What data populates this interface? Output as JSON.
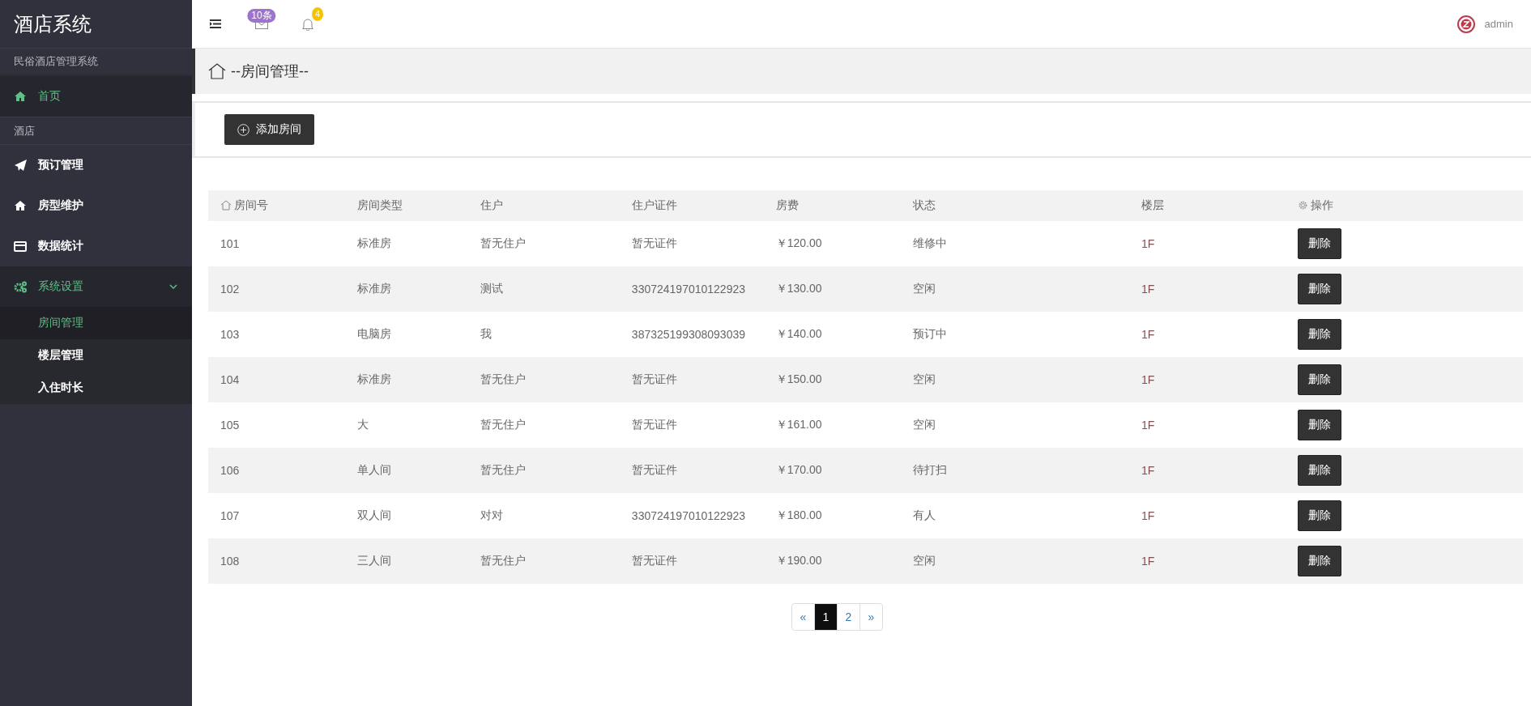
{
  "sidebar": {
    "title": "酒店系统",
    "subtitle": "民俗酒店管理系统",
    "items": [
      {
        "kind": "link",
        "label": "首页",
        "selected": true
      },
      {
        "kind": "section",
        "label": "酒店"
      },
      {
        "kind": "link",
        "label": "预订管理",
        "selected": false
      },
      {
        "kind": "link",
        "label": "房型维护",
        "selected": false
      },
      {
        "kind": "link",
        "label": "数据统计",
        "selected": false
      },
      {
        "kind": "menu",
        "label": "系统设置",
        "expanded": true,
        "children": [
          {
            "label": "房间管理",
            "selected": true
          },
          {
            "label": "楼层管理",
            "selected": false
          },
          {
            "label": "入住时长",
            "selected": false
          }
        ]
      }
    ]
  },
  "topbar": {
    "mail_badge": "10条",
    "bell_badge": "4",
    "user": "admin"
  },
  "page_title": "--房间管理--",
  "add_button": "添加房间",
  "table": {
    "columns": [
      "房间号",
      "房间类型",
      "住户",
      "住户证件",
      "房费",
      "状态",
      "楼层",
      "操作"
    ],
    "rows": [
      [
        "101",
        "标准房",
        "暂无住户",
        "暂无证件",
        "￥120.00",
        "维修中",
        "1F",
        "删除"
      ],
      [
        "102",
        "标准房",
        "测试",
        "330724197010122923",
        "￥130.00",
        "空闲",
        "1F",
        "删除"
      ],
      [
        "103",
        "电脑房",
        "我",
        "387325199308093039",
        "￥140.00",
        "预订中",
        "1F",
        "删除"
      ],
      [
        "104",
        "标准房",
        "暂无住户",
        "暂无证件",
        "￥150.00",
        "空闲",
        "1F",
        "删除"
      ],
      [
        "105",
        "大",
        "暂无住户",
        "暂无证件",
        "￥161.00",
        "空闲",
        "1F",
        "删除"
      ],
      [
        "106",
        "单人间",
        "暂无住户",
        "暂无证件",
        "￥170.00",
        "待打扫",
        "1F",
        "删除"
      ],
      [
        "107",
        "双人间",
        "对对",
        "330724197010122923",
        "￥180.00",
        "有人",
        "1F",
        "删除"
      ],
      [
        "108",
        "三人间",
        "暂无住户",
        "暂无证件",
        "￥190.00",
        "空闲",
        "1F",
        "删除"
      ]
    ]
  },
  "pagination": [
    {
      "label": "«",
      "selected": false
    },
    {
      "label": "1",
      "selected": true
    },
    {
      "label": "2",
      "selected": false
    },
    {
      "label": "»",
      "selected": false
    }
  ]
}
